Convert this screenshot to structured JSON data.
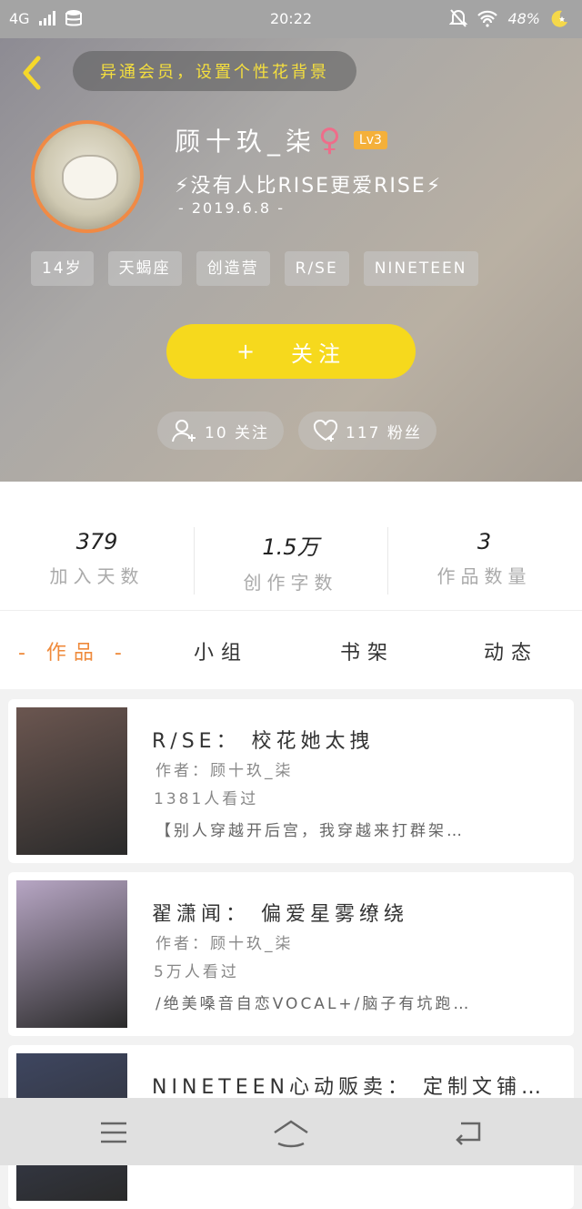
{
  "status_bar": {
    "network": "4G",
    "time": "20:22",
    "battery": "48%"
  },
  "header": {
    "back_icon": "chevron-left-icon",
    "banner_text": "异通会员，设置个性花背景"
  },
  "profile": {
    "name": "顾十玖_柒",
    "gender_symbol": "♀",
    "level": "Lv3",
    "signature": "⚡没有人比RISE更爱RISE⚡",
    "date": "- 2019.6.8 -",
    "tags": [
      "14岁",
      "天蝎座",
      "创造营",
      "R/SE",
      "NINETEEN"
    ],
    "follow_label": "关注",
    "follow_plus": "+",
    "following": "10 关注",
    "fans": "117 粉丝"
  },
  "stats": [
    {
      "value": "379",
      "label": "加入天数"
    },
    {
      "value": "1.5万",
      "label": "创作字数"
    },
    {
      "value": "3",
      "label": "作品数量"
    }
  ],
  "tabs": [
    {
      "label": "- 作品 -",
      "active": true
    },
    {
      "label": "小组",
      "active": false
    },
    {
      "label": "书架",
      "active": false
    },
    {
      "label": "动态",
      "active": false
    }
  ],
  "works": [
    {
      "title": "R/SE：  校花她太拽",
      "author": "作者：顾十玖_柒",
      "views": "1381人看过",
      "desc": "【别人穿越开后宫，我穿越来打群架…",
      "cover_color": "#6b5650"
    },
    {
      "title": "翟潇闻：  偏爱星雾缭绕",
      "author": "作者：顾十玖_柒",
      "views": "5万人看过",
      "desc": "/绝美嗓音自恋VOCAL+/脑子有坑跑…",
      "cover_color": "#b7a6c4"
    },
    {
      "title": "NINETEEN心动贩卖：  定制文铺…",
      "author": "",
      "views": "",
      "desc": "",
      "cover_color": "#3e4660"
    }
  ],
  "navbar": {
    "icons": [
      "menu-icon",
      "home-icon",
      "back-icon"
    ]
  }
}
